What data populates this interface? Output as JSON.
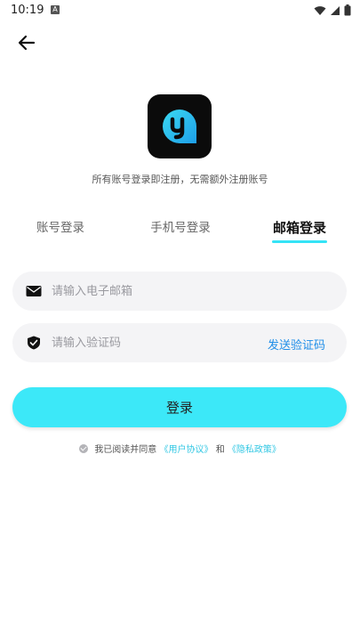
{
  "status_bar": {
    "time": "10:19",
    "notification_glyph": "A"
  },
  "subtitle": "所有账号登录即注册，无需额外注册账号",
  "tabs": [
    {
      "label": "账号登录",
      "active": false
    },
    {
      "label": "手机号登录",
      "active": false
    },
    {
      "label": "邮箱登录",
      "active": true
    }
  ],
  "email_field": {
    "placeholder": "请输入电子邮箱",
    "value": ""
  },
  "code_field": {
    "placeholder": "请输入验证码",
    "value": "",
    "send_code_label": "发送验证码"
  },
  "login_button": {
    "label": "登录"
  },
  "agreement": {
    "prefix": "我已阅读并同意",
    "user_agreement": "《用户协议》",
    "conjunction": "和",
    "privacy_policy": "《隐私政策》"
  },
  "colors": {
    "accent": "#3ce8f8",
    "link": "#1f8ee8",
    "field_bg": "#f4f4f6",
    "logo_bg": "#0b0b0b"
  }
}
